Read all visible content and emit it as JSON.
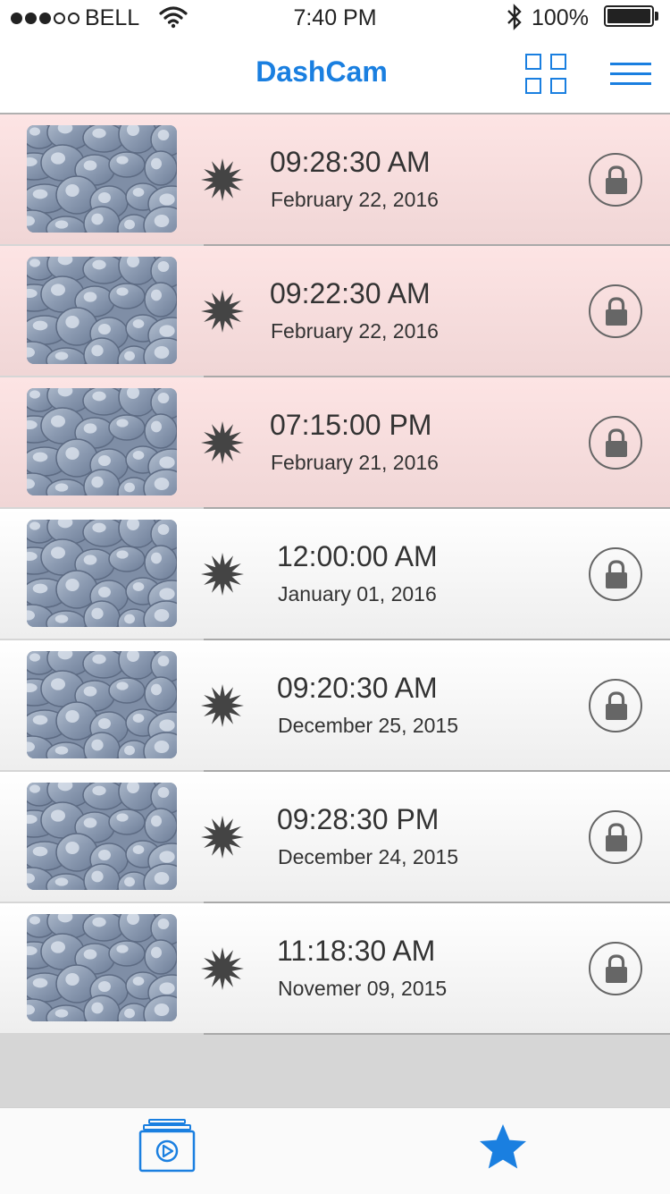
{
  "status_bar": {
    "carrier": "BELL",
    "signal_bars_filled": 3,
    "signal_bars_total": 5,
    "time": "7:40 PM",
    "battery": "100%",
    "icons": [
      "wifi-icon",
      "bluetooth-icon",
      "battery-icon"
    ]
  },
  "nav": {
    "title": "DashCam",
    "icons": [
      "grid-view-icon",
      "menu-icon"
    ]
  },
  "colors": {
    "accent": "#1a7fe0",
    "alert_row": "#fde4e4",
    "normal_row": "#ffffff"
  },
  "clips": [
    {
      "time": "09:28:30 AM",
      "date": "February 22, 2016",
      "alert": true
    },
    {
      "time": "09:22:30 AM",
      "date": "February 22, 2016",
      "alert": true
    },
    {
      "time": "07:15:00 PM",
      "date": "February 21, 2016",
      "alert": true
    },
    {
      "time": "12:00:00 AM",
      "date": "January 01, 2016",
      "alert": false
    },
    {
      "time": "09:20:30 AM",
      "date": "December 25, 2015",
      "alert": false
    },
    {
      "time": "09:28:30 PM",
      "date": "December 24, 2015",
      "alert": false
    },
    {
      "time": "11:18:30 AM",
      "date": "Novemer 09, 2015",
      "alert": false
    }
  ],
  "clip_icons": [
    "video-thumbnail",
    "impact-burst-icon",
    "lock-icon"
  ],
  "tab_bar": {
    "tabs": [
      {
        "icon": "video-clips-icon",
        "selected": false
      },
      {
        "icon": "star-icon",
        "selected": true
      }
    ]
  }
}
